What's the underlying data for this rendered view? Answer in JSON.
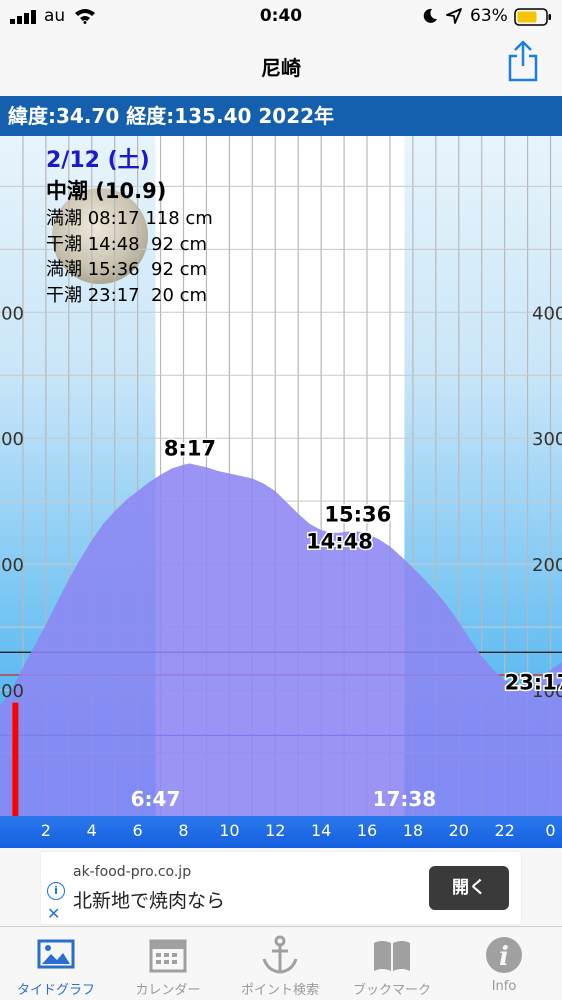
{
  "status_bar": {
    "carrier": "au",
    "time": "0:40",
    "battery_pct": "63%"
  },
  "nav": {
    "title": "尼崎"
  },
  "info_bar": {
    "text": "緯度:34.70 経度:135.40  2022年"
  },
  "day_info": {
    "date": "2/12 (土)",
    "tide_name": "中潮 (10.9)",
    "rows": [
      "満潮 08:17 118 cm",
      "干潮 14:48  92 cm",
      "満潮 15:36  92 cm",
      "干潮 23:17  20 cm"
    ]
  },
  "chart_data": {
    "type": "area",
    "y_ticks": [
      "400",
      "300",
      "200",
      "100"
    ],
    "x_ticks": [
      "2",
      "4",
      "6",
      "8",
      "10",
      "12",
      "14",
      "16",
      "18",
      "20",
      "22",
      "0"
    ],
    "xlim": [
      0,
      24.5
    ],
    "ylim": [
      0,
      540
    ],
    "curve": [
      [
        0,
        88
      ],
      [
        0.5,
        100
      ],
      [
        1,
        118
      ],
      [
        1.5,
        135
      ],
      [
        2,
        152
      ],
      [
        2.5,
        170
      ],
      [
        3,
        188
      ],
      [
        3.5,
        204
      ],
      [
        4,
        219
      ],
      [
        4.5,
        232
      ],
      [
        5,
        242
      ],
      [
        5.5,
        251
      ],
      [
        6,
        258
      ],
      [
        6.5,
        265
      ],
      [
        7,
        271
      ],
      [
        7.5,
        276
      ],
      [
        8,
        279
      ],
      [
        8.28,
        280
      ],
      [
        8.5,
        279
      ],
      [
        9,
        277
      ],
      [
        9.5,
        274
      ],
      [
        10,
        272
      ],
      [
        10.5,
        270
      ],
      [
        11,
        268
      ],
      [
        11.5,
        264
      ],
      [
        12,
        258
      ],
      [
        12.5,
        249
      ],
      [
        13,
        240
      ],
      [
        13.5,
        232
      ],
      [
        14,
        227
      ],
      [
        14.5,
        225
      ],
      [
        14.8,
        225
      ],
      [
        15.2,
        226
      ],
      [
        15.6,
        226
      ],
      [
        16,
        224
      ],
      [
        16.5,
        220
      ],
      [
        17,
        214
      ],
      [
        17.5,
        206
      ],
      [
        18,
        197
      ],
      [
        18.5,
        188
      ],
      [
        19,
        178
      ],
      [
        19.5,
        167
      ],
      [
        20,
        154
      ],
      [
        20.5,
        140
      ],
      [
        21,
        127
      ],
      [
        21.5,
        116
      ],
      [
        22,
        108
      ],
      [
        22.5,
        105
      ],
      [
        23,
        105
      ],
      [
        23.3,
        107
      ],
      [
        23.7,
        111
      ],
      [
        24,
        116
      ],
      [
        24.5,
        122
      ]
    ],
    "sunrise": "6:47",
    "sunset": "17:38",
    "sunrise_hour": 6.78,
    "sunset_hour": 17.63,
    "events": [
      {
        "label": "8:17",
        "hour": 8.28,
        "value": 118
      },
      {
        "label": "14:48",
        "hour": 14.8,
        "value": 92
      },
      {
        "label": "15:36",
        "hour": 15.6,
        "value": 92
      },
      {
        "label": "23:17",
        "hour": 23.28,
        "value": 20
      }
    ],
    "hlines": [
      {
        "value": 130,
        "color": "#222222"
      },
      {
        "value": 112,
        "color": "#e02020"
      },
      {
        "value": 64,
        "color": "#2020c0"
      }
    ],
    "current_hour": 0.67,
    "colors": {
      "sky_top": "#e8f4fc",
      "sky_bottom": "#2fa8f0",
      "daylight": "#ffffff",
      "tide_fill": "#8c86f2",
      "current_marker": "#ff0000",
      "axis_band": "#2a6fe8"
    }
  },
  "ad": {
    "domain": "ak-food-pro.co.jp",
    "text": "北新地で焼肉なら",
    "button": "開く"
  },
  "tabs": [
    {
      "label": "タイドグラフ",
      "icon": "image-icon"
    },
    {
      "label": "カレンダー",
      "icon": "calendar-icon"
    },
    {
      "label": "ポイント検索",
      "icon": "anchor-icon"
    },
    {
      "label": "ブックマーク",
      "icon": "book-icon"
    },
    {
      "label": "Info",
      "icon": "info-icon"
    }
  ]
}
